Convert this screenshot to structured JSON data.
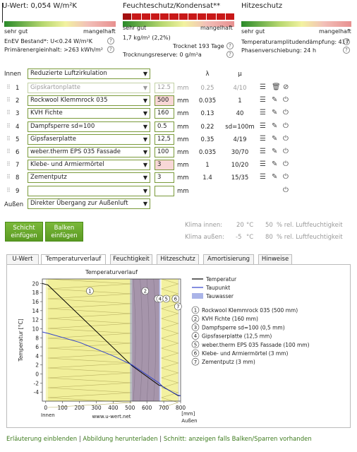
{
  "uwert": {
    "title": "U-Wert: 0,054 W/m²K",
    "good": "sehr gut",
    "bad": "mangelhaft",
    "enev": "EnEV Bestand*: U<0.24 W/m²K",
    "primary": "Primärenergieinhalt: >263 kWh/m²"
  },
  "feucht": {
    "title": "Feuchteschutz/Kondensat**",
    "good": "sehr gut",
    "bad": "mangelhaft",
    "trocknet": "Trocknet 193 Tage",
    "amount": "1,7 kg/m² (2,2%)",
    "reserve": "Trocknungsreserve: 0 g/m²a"
  },
  "hitze": {
    "title": "Hitzeschutz",
    "good": "sehr gut",
    "bad": "mangelhaft",
    "amp": "Temperaturamplitudendämpfung: 417",
    "phase": "Phasenverschiebung: 24 h"
  },
  "inner_label": "Innen",
  "outer_label": "Außen",
  "inner_select": "Reduzierte Luftzirkulation",
  "outer_select": "Direkter Übergang zur Außenluft",
  "col_lambda": "λ",
  "col_mu": "μ",
  "unit": "mm",
  "layers": [
    {
      "idx": "1",
      "name": "Gipskartonplatte",
      "thick": "12.5",
      "lambda": "0.25",
      "mu": "4/10",
      "disabled": true
    },
    {
      "idx": "2",
      "name": "Rockwool Klemmrock 035",
      "thick": "500",
      "lambda": "0.035",
      "mu": "1",
      "red": true
    },
    {
      "idx": "3",
      "name": "KVH Fichte",
      "thick": "160",
      "lambda": "0.13",
      "mu": "40"
    },
    {
      "idx": "4",
      "name": "Dampfsperre sd=100",
      "thick": "0.5",
      "lambda": "0.22",
      "mu": "sd=100m"
    },
    {
      "idx": "5",
      "name": "Gipsfaserplatte",
      "thick": "12,5",
      "lambda": "0.35",
      "mu": "4/19"
    },
    {
      "idx": "6",
      "name": "weber.therm EPS 035 Fassade",
      "thick": "100",
      "lambda": "0.035",
      "mu": "30/70"
    },
    {
      "idx": "7",
      "name": "Klebe- und Armiermörtel",
      "thick": "3",
      "lambda": "1",
      "mu": "10/20",
      "red": true
    },
    {
      "idx": "8",
      "name": "Zementputz",
      "thick": "3",
      "lambda": "1.4",
      "mu": "15/35"
    },
    {
      "idx": "9",
      "name": "",
      "thick": "",
      "lambda": "",
      "mu": ""
    }
  ],
  "buttons": {
    "schicht": "Schicht einfügen",
    "balken": "Balken einfügen"
  },
  "klima": {
    "innen_label": "Klima innen:",
    "innen_temp": "20",
    "innen_hum": "50",
    "aussen_label": "Klima außen:",
    "aussen_temp": "-5",
    "aussen_hum": "80",
    "unit_c": "°C",
    "unit_h": "% rel. Luftfeuchtigkeit"
  },
  "tabs": [
    "U-Wert",
    "Temperaturverlauf",
    "Feuchtigkeit",
    "Hitzeschutz",
    "Amortisierung",
    "Hinweise"
  ],
  "chart_data": {
    "type": "line",
    "title": "Temperaturverlauf",
    "ylabel": "Temperatur [°C]",
    "xlabel": "[mm]",
    "x_left_label": "Innen",
    "x_right_label": "Außen",
    "source": "www.u-wert.net",
    "xlim": [
      -20,
      800
    ],
    "ylim": [
      -6,
      21
    ],
    "xticks": [
      0,
      100,
      200,
      300,
      400,
      500,
      600,
      700,
      800
    ],
    "yticks": [
      20,
      18,
      16,
      14,
      12,
      10,
      8,
      6,
      4,
      2,
      0,
      -2,
      -4
    ],
    "layers": [
      {
        "from": 0,
        "to": 12.5,
        "color": "#f5f5b8"
      },
      {
        "from": 12.5,
        "to": 512.5,
        "color": "#f1ef9a"
      },
      {
        "from": 512.5,
        "to": 672.5,
        "color": "#c7956a"
      },
      {
        "from": 672.5,
        "to": 673,
        "color": "#3b3b3b"
      },
      {
        "from": 673,
        "to": 685.5,
        "color": "#ffffff"
      },
      {
        "from": 685.5,
        "to": 785.5,
        "color": "#f3f1a0"
      },
      {
        "from": 785.5,
        "to": 791.5,
        "color": "#d8d8d8"
      }
    ],
    "tauwasser": [
      500,
      680
    ],
    "series": [
      {
        "name": "Temperatur",
        "color": "#000000",
        "x": [
          -20,
          0,
          12.5,
          512.5,
          672.5,
          685.5,
          785.5,
          791.5,
          800
        ],
        "y": [
          20,
          19.8,
          19.7,
          1.8,
          -2.5,
          -2.6,
          -4.8,
          -4.8,
          -4.8
        ]
      },
      {
        "name": "Taupunkt",
        "color": "#3344cc",
        "x": [
          -20,
          0,
          12.5,
          200,
          400,
          512.5,
          672.5,
          700,
          785.5,
          800
        ],
        "y": [
          9.3,
          9.1,
          9,
          7,
          4,
          2,
          -2,
          -3,
          -4.7,
          -4.8
        ]
      }
    ],
    "legend": [
      {
        "label": "Temperatur",
        "kind": "line",
        "color": "#000000"
      },
      {
        "label": "Taupunkt",
        "kind": "line",
        "color": "#3344cc"
      },
      {
        "label": "Tauwasser",
        "kind": "box",
        "color": "#aab4e8"
      }
    ],
    "numbered": [
      "Rockwool Klemmrock 035 (500 mm)",
      "KVH Fichte (160 mm)",
      "Dampfsperre sd=100 (0,5 mm)",
      "Gipsfaserplatte (12,5 mm)",
      "weber.therm EPS 035 Fassade (100 mm)",
      "Klebe- und Armiermörtel (3 mm)",
      "Zementputz (3 mm)"
    ]
  },
  "footer": {
    "erl": "Erläuterung einblenden",
    "abb": "Abbildung herunterladen",
    "schnitt": "Schnitt: anzeigen falls Balken/Sparren vorhanden",
    "sep": "|"
  },
  "colors": {
    "accent": "#6aaa2a",
    "red": "#c21010",
    "green": "#2f7a28"
  }
}
